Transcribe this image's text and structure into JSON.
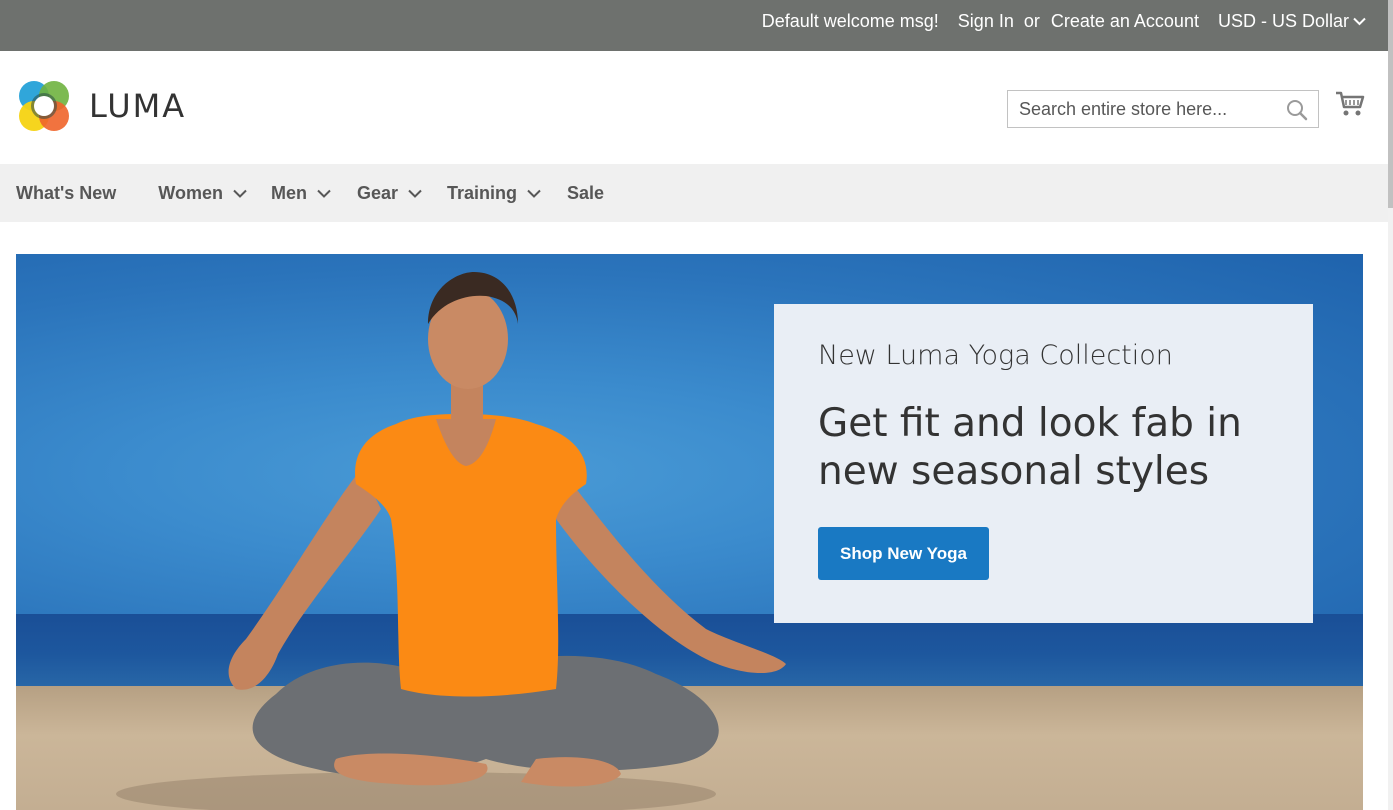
{
  "topbar": {
    "welcome": "Default welcome msg!",
    "sign_in": "Sign In",
    "or": "or",
    "create_account": "Create an Account",
    "currency": "USD - US Dollar"
  },
  "header": {
    "logo_text": "LUMA",
    "search_placeholder": "Search entire store here...",
    "search_icon": "magnifier-icon",
    "cart_icon": "shopping-cart-icon"
  },
  "nav": {
    "items": [
      {
        "label": "What's New",
        "has_dropdown": false
      },
      {
        "label": "Women",
        "has_dropdown": true
      },
      {
        "label": "Men",
        "has_dropdown": true
      },
      {
        "label": "Gear",
        "has_dropdown": true
      },
      {
        "label": "Training",
        "has_dropdown": true
      },
      {
        "label": "Sale",
        "has_dropdown": false
      }
    ]
  },
  "hero": {
    "subtitle": "New Luma Yoga Collection",
    "headline": "Get fit and look fab in new seasonal styles",
    "button_label": "Shop New Yoga",
    "image": "woman-meditating-on-beach"
  },
  "colors": {
    "topbar_bg": "#6e716e",
    "nav_bg": "#f0f0f0",
    "primary_button": "#1979c3",
    "promo_bg": "#e9eef5"
  }
}
